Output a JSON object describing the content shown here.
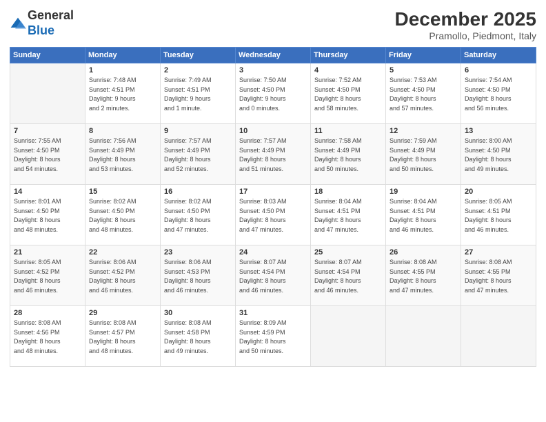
{
  "logo": {
    "general": "General",
    "blue": "Blue"
  },
  "header": {
    "month": "December 2025",
    "location": "Pramollo, Piedmont, Italy"
  },
  "weekdays": [
    "Sunday",
    "Monday",
    "Tuesday",
    "Wednesday",
    "Thursday",
    "Friday",
    "Saturday"
  ],
  "weeks": [
    [
      {
        "day": "",
        "info": ""
      },
      {
        "day": "1",
        "info": "Sunrise: 7:48 AM\nSunset: 4:51 PM\nDaylight: 9 hours\nand 2 minutes."
      },
      {
        "day": "2",
        "info": "Sunrise: 7:49 AM\nSunset: 4:51 PM\nDaylight: 9 hours\nand 1 minute."
      },
      {
        "day": "3",
        "info": "Sunrise: 7:50 AM\nSunset: 4:50 PM\nDaylight: 9 hours\nand 0 minutes."
      },
      {
        "day": "4",
        "info": "Sunrise: 7:52 AM\nSunset: 4:50 PM\nDaylight: 8 hours\nand 58 minutes."
      },
      {
        "day": "5",
        "info": "Sunrise: 7:53 AM\nSunset: 4:50 PM\nDaylight: 8 hours\nand 57 minutes."
      },
      {
        "day": "6",
        "info": "Sunrise: 7:54 AM\nSunset: 4:50 PM\nDaylight: 8 hours\nand 56 minutes."
      }
    ],
    [
      {
        "day": "7",
        "info": "Sunrise: 7:55 AM\nSunset: 4:50 PM\nDaylight: 8 hours\nand 54 minutes."
      },
      {
        "day": "8",
        "info": "Sunrise: 7:56 AM\nSunset: 4:49 PM\nDaylight: 8 hours\nand 53 minutes."
      },
      {
        "day": "9",
        "info": "Sunrise: 7:57 AM\nSunset: 4:49 PM\nDaylight: 8 hours\nand 52 minutes."
      },
      {
        "day": "10",
        "info": "Sunrise: 7:57 AM\nSunset: 4:49 PM\nDaylight: 8 hours\nand 51 minutes."
      },
      {
        "day": "11",
        "info": "Sunrise: 7:58 AM\nSunset: 4:49 PM\nDaylight: 8 hours\nand 50 minutes."
      },
      {
        "day": "12",
        "info": "Sunrise: 7:59 AM\nSunset: 4:49 PM\nDaylight: 8 hours\nand 50 minutes."
      },
      {
        "day": "13",
        "info": "Sunrise: 8:00 AM\nSunset: 4:50 PM\nDaylight: 8 hours\nand 49 minutes."
      }
    ],
    [
      {
        "day": "14",
        "info": "Sunrise: 8:01 AM\nSunset: 4:50 PM\nDaylight: 8 hours\nand 48 minutes."
      },
      {
        "day": "15",
        "info": "Sunrise: 8:02 AM\nSunset: 4:50 PM\nDaylight: 8 hours\nand 48 minutes."
      },
      {
        "day": "16",
        "info": "Sunrise: 8:02 AM\nSunset: 4:50 PM\nDaylight: 8 hours\nand 47 minutes."
      },
      {
        "day": "17",
        "info": "Sunrise: 8:03 AM\nSunset: 4:50 PM\nDaylight: 8 hours\nand 47 minutes."
      },
      {
        "day": "18",
        "info": "Sunrise: 8:04 AM\nSunset: 4:51 PM\nDaylight: 8 hours\nand 47 minutes."
      },
      {
        "day": "19",
        "info": "Sunrise: 8:04 AM\nSunset: 4:51 PM\nDaylight: 8 hours\nand 46 minutes."
      },
      {
        "day": "20",
        "info": "Sunrise: 8:05 AM\nSunset: 4:51 PM\nDaylight: 8 hours\nand 46 minutes."
      }
    ],
    [
      {
        "day": "21",
        "info": "Sunrise: 8:05 AM\nSunset: 4:52 PM\nDaylight: 8 hours\nand 46 minutes."
      },
      {
        "day": "22",
        "info": "Sunrise: 8:06 AM\nSunset: 4:52 PM\nDaylight: 8 hours\nand 46 minutes."
      },
      {
        "day": "23",
        "info": "Sunrise: 8:06 AM\nSunset: 4:53 PM\nDaylight: 8 hours\nand 46 minutes."
      },
      {
        "day": "24",
        "info": "Sunrise: 8:07 AM\nSunset: 4:54 PM\nDaylight: 8 hours\nand 46 minutes."
      },
      {
        "day": "25",
        "info": "Sunrise: 8:07 AM\nSunset: 4:54 PM\nDaylight: 8 hours\nand 46 minutes."
      },
      {
        "day": "26",
        "info": "Sunrise: 8:08 AM\nSunset: 4:55 PM\nDaylight: 8 hours\nand 47 minutes."
      },
      {
        "day": "27",
        "info": "Sunrise: 8:08 AM\nSunset: 4:55 PM\nDaylight: 8 hours\nand 47 minutes."
      }
    ],
    [
      {
        "day": "28",
        "info": "Sunrise: 8:08 AM\nSunset: 4:56 PM\nDaylight: 8 hours\nand 48 minutes."
      },
      {
        "day": "29",
        "info": "Sunrise: 8:08 AM\nSunset: 4:57 PM\nDaylight: 8 hours\nand 48 minutes."
      },
      {
        "day": "30",
        "info": "Sunrise: 8:08 AM\nSunset: 4:58 PM\nDaylight: 8 hours\nand 49 minutes."
      },
      {
        "day": "31",
        "info": "Sunrise: 8:09 AM\nSunset: 4:59 PM\nDaylight: 8 hours\nand 50 minutes."
      },
      {
        "day": "",
        "info": ""
      },
      {
        "day": "",
        "info": ""
      },
      {
        "day": "",
        "info": ""
      }
    ]
  ]
}
